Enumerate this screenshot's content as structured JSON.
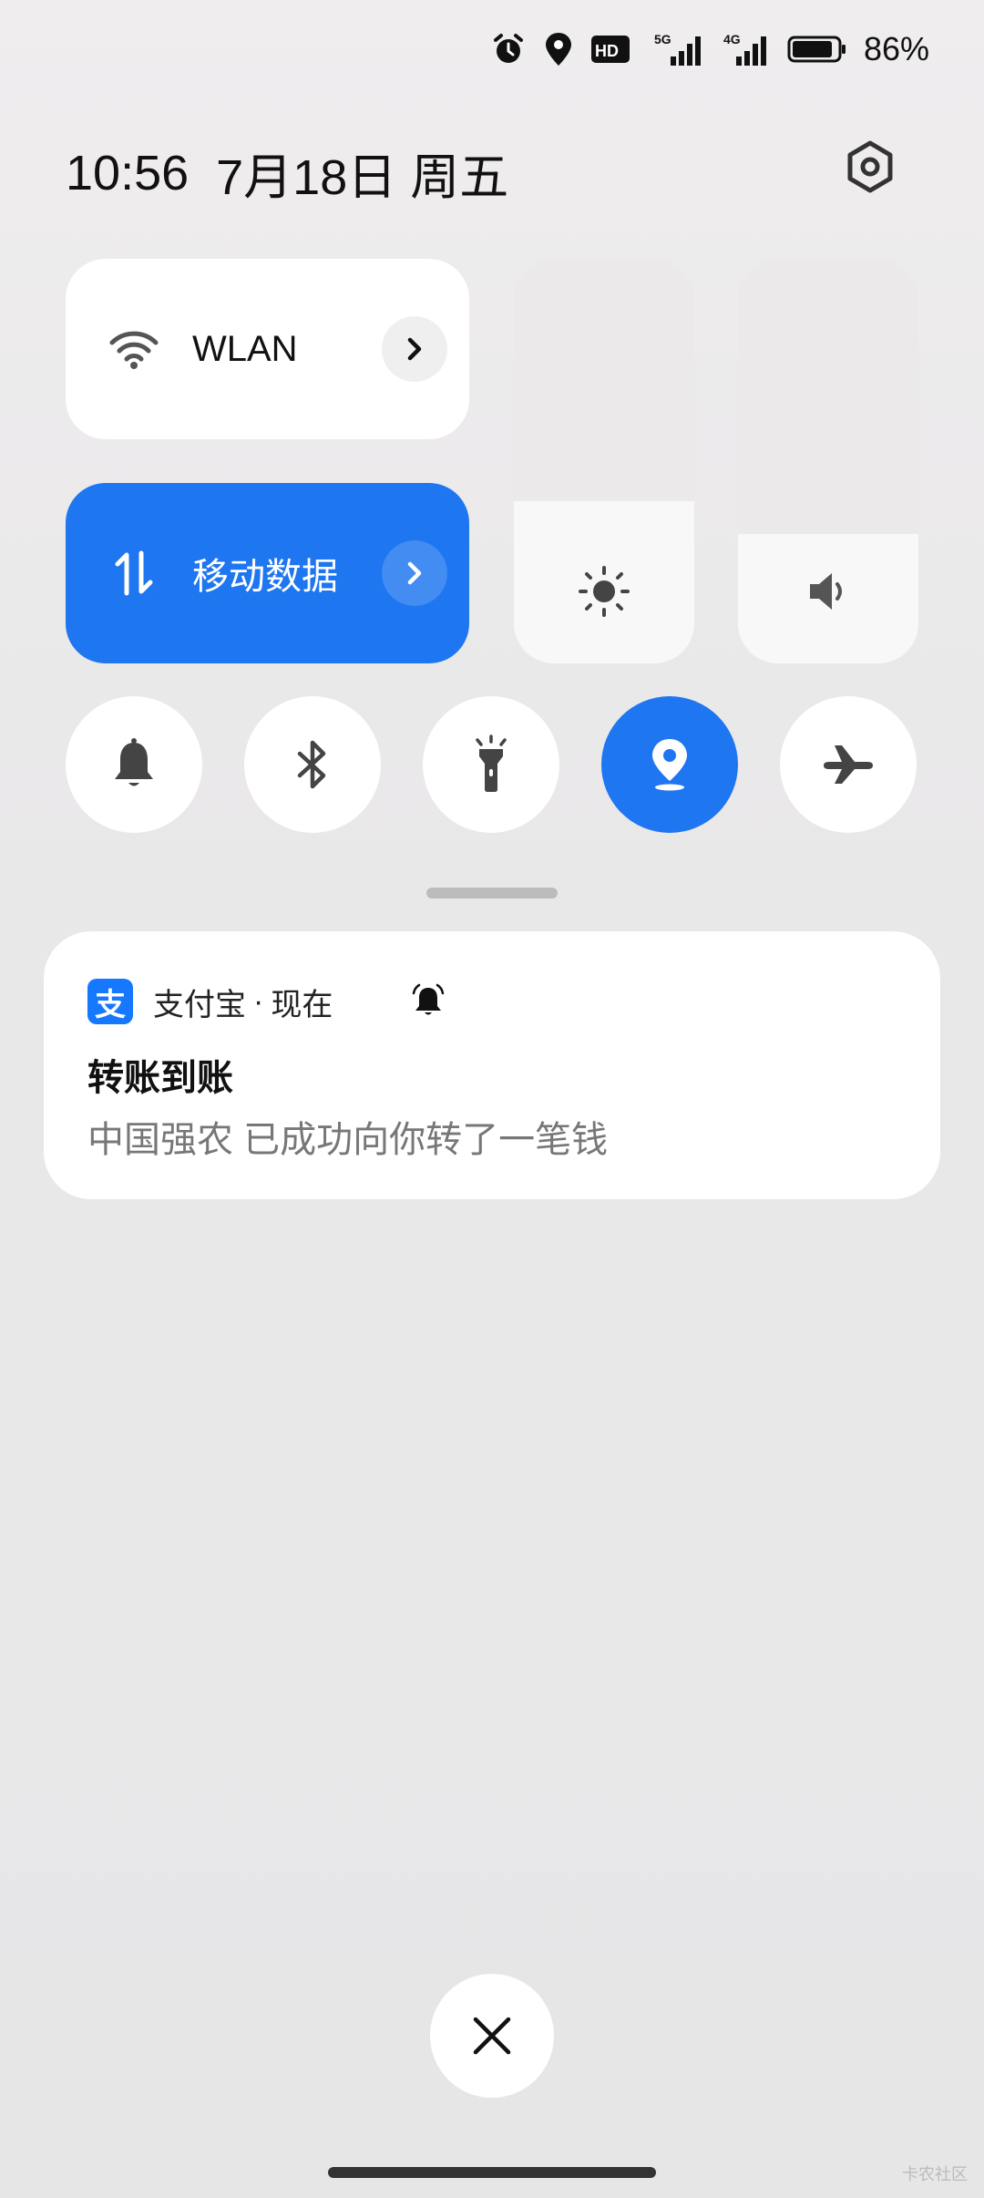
{
  "status_bar": {
    "icons": [
      "alarm-icon",
      "location-icon",
      "hd-icon",
      "5g-signal-icon",
      "4g-signal-icon",
      "battery-icon"
    ],
    "hd_label": "HD",
    "net1_label": "5G",
    "net2_label": "4G",
    "battery_percent": "86%",
    "battery_level": 0.86
  },
  "header": {
    "time": "10:56",
    "date": "7月18日",
    "weekday": "周五"
  },
  "tiles": {
    "wlan": {
      "label": "WLAN",
      "active": false
    },
    "mobile_data": {
      "label": "移动数据",
      "active": true
    }
  },
  "sliders": {
    "brightness_level": 0.4,
    "volume_level": 0.32
  },
  "toggles": [
    {
      "name": "ring",
      "icon": "bell-icon",
      "active": false
    },
    {
      "name": "bluetooth",
      "icon": "bluetooth-icon",
      "active": false
    },
    {
      "name": "flashlight",
      "icon": "flashlight-icon",
      "active": false
    },
    {
      "name": "location",
      "icon": "location-icon",
      "active": true
    },
    {
      "name": "airplane",
      "icon": "airplane-icon",
      "active": false
    }
  ],
  "notification": {
    "app_icon_char": "支",
    "app_name": "支付宝",
    "separator": "·",
    "time": "现在",
    "title": "转账到账",
    "body": "中国强农 已成功向你转了一笔钱"
  },
  "colors": {
    "accent": "#1e76f0",
    "alipay_blue": "#1677ff"
  },
  "watermark": "卡农社区"
}
